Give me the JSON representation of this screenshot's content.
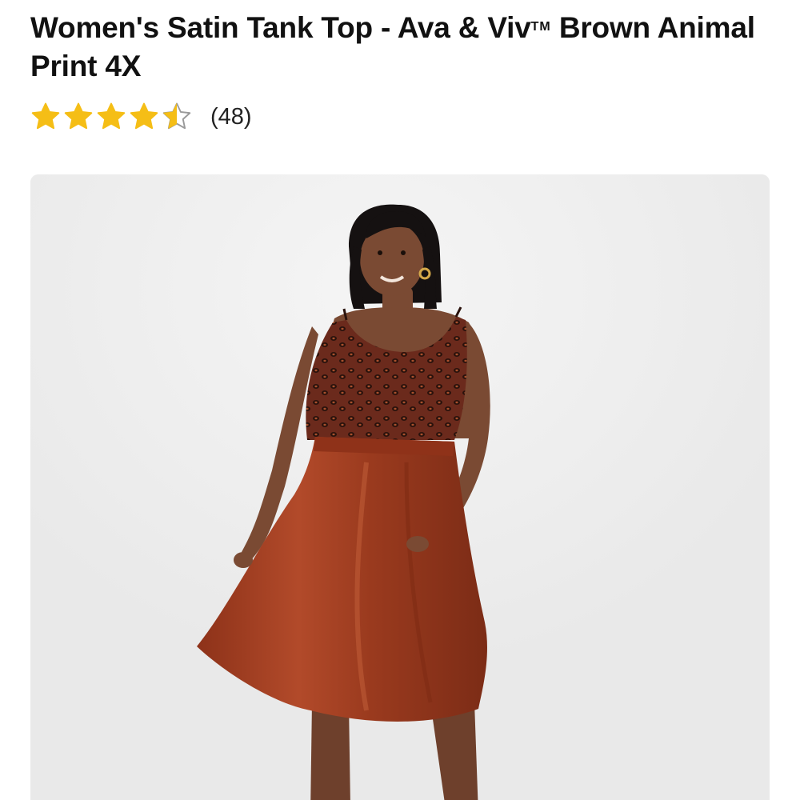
{
  "product": {
    "title_main": "Women's Satin Tank Top - Ava & Viv",
    "title_tm": "TM",
    "title_rest": " Brown Animal Print 4X"
  },
  "rating": {
    "value": 4.5,
    "max": 5,
    "review_count": "(48)",
    "star_color": "#F5BE16",
    "star_outline_color": "#9a9a9a"
  },
  "image": {
    "background_color": "#EDEDED",
    "top_color": "#6B2A1C",
    "skirt_color": "#A33E22",
    "skin_color": "#7A4A33",
    "hair_color": "#151111"
  }
}
